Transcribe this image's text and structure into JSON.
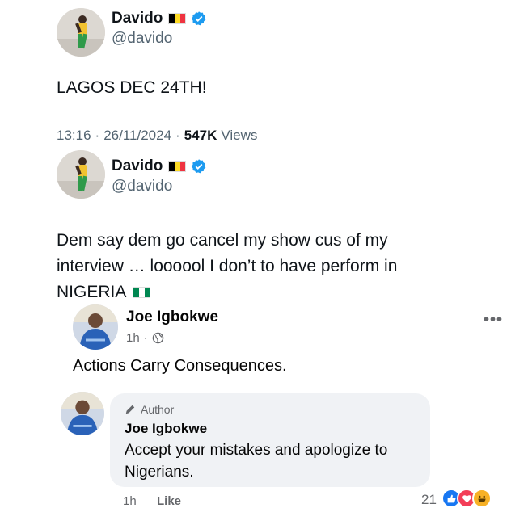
{
  "tweets": [
    {
      "display_name": "Davido",
      "handle": "@davido",
      "flag": [
        "#000000",
        "#FDDA24",
        "#EF3340"
      ],
      "text": "LAGOS DEC 24TH!",
      "time": "13:16",
      "date": "26/11/2024",
      "views_count": "547K",
      "views_label": "Views"
    },
    {
      "display_name": "Davido",
      "handle": "@davido",
      "flag": [
        "#000000",
        "#FDDA24",
        "#EF3340"
      ],
      "text_lines": [
        "Dem say dem go cancel my show cus of my",
        "interview … loooool I don’t to have perform in",
        "NIGERIA"
      ],
      "text_flag": [
        "#008751",
        "#ffffff",
        "#008751"
      ]
    }
  ],
  "comment": {
    "author": "Joe Igbokwe",
    "time": "1h",
    "separator": "·",
    "audience_icon": "globe-icon",
    "text": "Actions Carry Consequences.",
    "more_icon": "more-options-icon",
    "more_glyph": "•••"
  },
  "reply": {
    "badge_label": "Author",
    "badge_icon": "pen-icon",
    "author": "Joe Igbokwe",
    "text": "Accept your mistakes and apologize to Nigerians.",
    "time": "1h",
    "like_label": "Like",
    "reaction_count": "21",
    "reactions": [
      {
        "icon": "like-reaction-icon",
        "color": "#1877f2",
        "glyph": "👍"
      },
      {
        "icon": "love-reaction-icon",
        "color": "#f33e58",
        "glyph": "♥"
      },
      {
        "icon": "haha-reaction-icon",
        "color": "#f7b125",
        "glyph": "😆"
      }
    ]
  },
  "colors": {
    "verified": "#1d9bf0",
    "text_primary": "#0f1419",
    "text_secondary": "#536471"
  }
}
